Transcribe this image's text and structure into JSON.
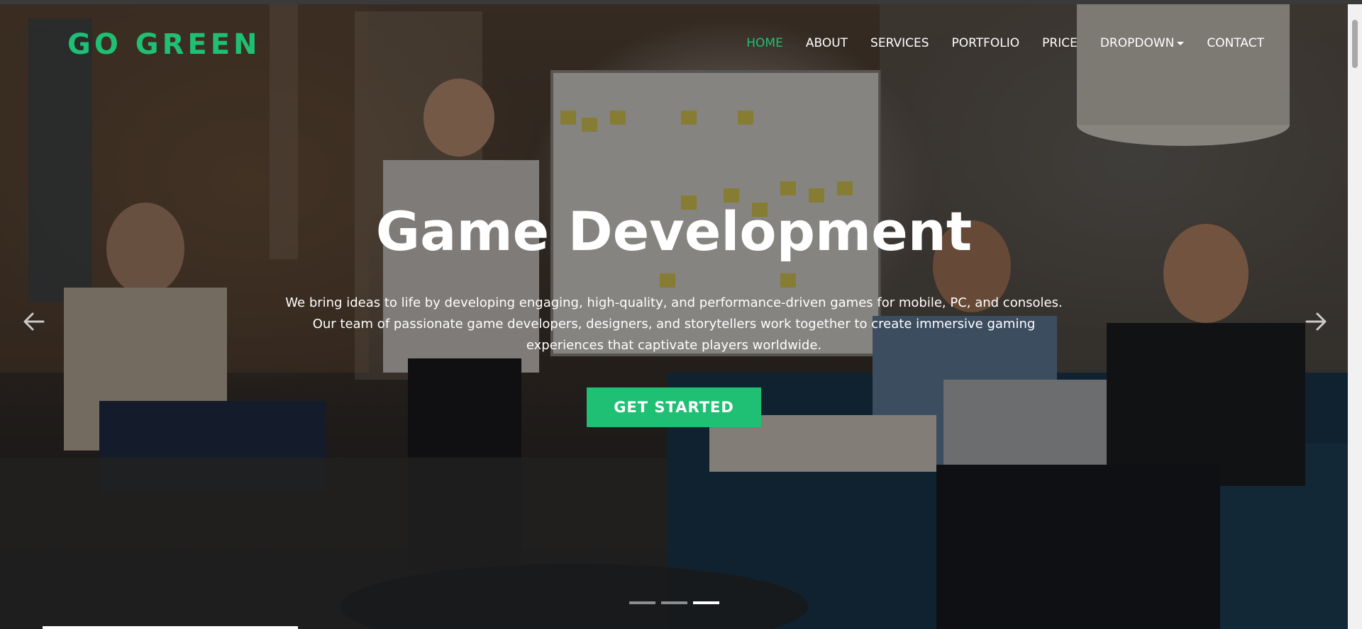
{
  "brand": {
    "logo": "GO GREEN",
    "accent_color": "#1fc074"
  },
  "nav": {
    "items": [
      {
        "label": "HOME",
        "active": true
      },
      {
        "label": "ABOUT"
      },
      {
        "label": "SERVICES"
      },
      {
        "label": "PORTFOLIO"
      },
      {
        "label": "PRICE"
      },
      {
        "label": "DROPDOWN",
        "has_caret": true
      },
      {
        "label": "CONTACT"
      }
    ]
  },
  "hero": {
    "title": "Game Development",
    "description": "We bring ideas to life by developing engaging, high-quality, and performance-driven games for mobile, PC, and consoles. Our team of passionate game developers, designers, and storytellers work together to create immersive gaming experiences that captivate players worldwide.",
    "cta_label": "GET STARTED",
    "background_icon": "office-team-meeting-photo"
  },
  "carousel": {
    "prev_icon": "arrow-left-icon",
    "next_icon": "arrow-right-icon",
    "slide_count": 3,
    "active_slide": 3
  }
}
